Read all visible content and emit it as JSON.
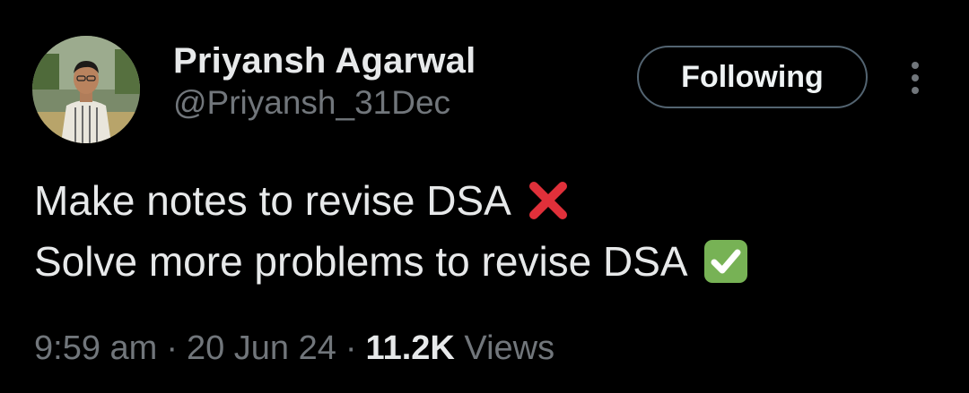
{
  "user": {
    "display_name": "Priyansh Agarwal",
    "handle": "@Priyansh_31Dec"
  },
  "follow_button": {
    "label": "Following"
  },
  "more_menu": {
    "icon": "more-vertical-icon"
  },
  "tweet": {
    "lines": [
      {
        "text": "Make notes to revise DSA",
        "emoji": "cross-mark-icon"
      },
      {
        "text": "Solve more problems to revise DSA",
        "emoji": "check-mark-button-icon"
      }
    ]
  },
  "meta": {
    "time": "9:59 am",
    "separator": "·",
    "date": "20 Jun 24",
    "views_count": "11.2K",
    "views_label": "Views"
  },
  "colors": {
    "background": "#000000",
    "primary_text": "#e7e9ea",
    "secondary_text": "#71767b",
    "button_border": "#536471",
    "cross_red": "#e0303a",
    "check_green": "#77b255"
  }
}
